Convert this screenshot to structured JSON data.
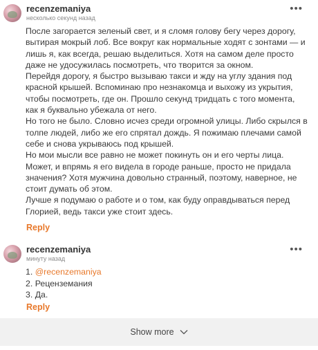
{
  "comments": [
    {
      "author": "recenzemaniya",
      "time": "несколько секунд назад",
      "more": "•••",
      "paragraphs": [
        "После загорается зеленый свет, и я сломя голову бегу через дорогу, вытирая мокрый лоб. Все вокруг как нормальные ходят с зонтами — и лишь я, как всегда, решаю выделиться. Хотя на самом деле просто даже не удосужилась посмотреть, что творится за окном.",
        "Перейдя дорогу, я быстро вызываю такси и жду на углу здания под красной крышей. Вспоминаю про незнакомца и выхожу из укрытия, чтобы посмотреть, где он. Прошло секунд тридцать с того момента, как я буквально убежала от него.",
        "Но того не было. Словно исчез среди огромной улицы. Либо скрылся в толпе людей, либо же его спрятал дождь. Я пожимаю плечами самой себе и снова укрываюсь под крышей.",
        "Но мои мысли все равно не может покинуть он и его черты лица. Может, и впрямь я его видела в городе раньше, просто не придала значения? Хотя мужчина довольно странный, поэтому, наверное, не стоит думать об этом.",
        "Лучше я подумаю о работе и о том, как буду оправдываться перед Глорией, ведь такси уже стоит здесь."
      ],
      "reply_label": "Reply"
    },
    {
      "author": "recenzemaniya",
      "time": "минуту назад",
      "more": "•••",
      "list": [
        {
          "num": "1.",
          "text": "@recenzemaniya"
        },
        {
          "num": "2.",
          "text": "Реценземания"
        },
        {
          "num": "3.",
          "text": "Да."
        }
      ],
      "reply_label": "Reply"
    }
  ],
  "show_more": {
    "label": "Show more",
    "icon": "chevron-down-icon"
  },
  "colors": {
    "accent": "#e8782a",
    "text": "#3a3a3a",
    "muted": "#8a8a8a",
    "show_more_bg": "#f1f1f1"
  }
}
